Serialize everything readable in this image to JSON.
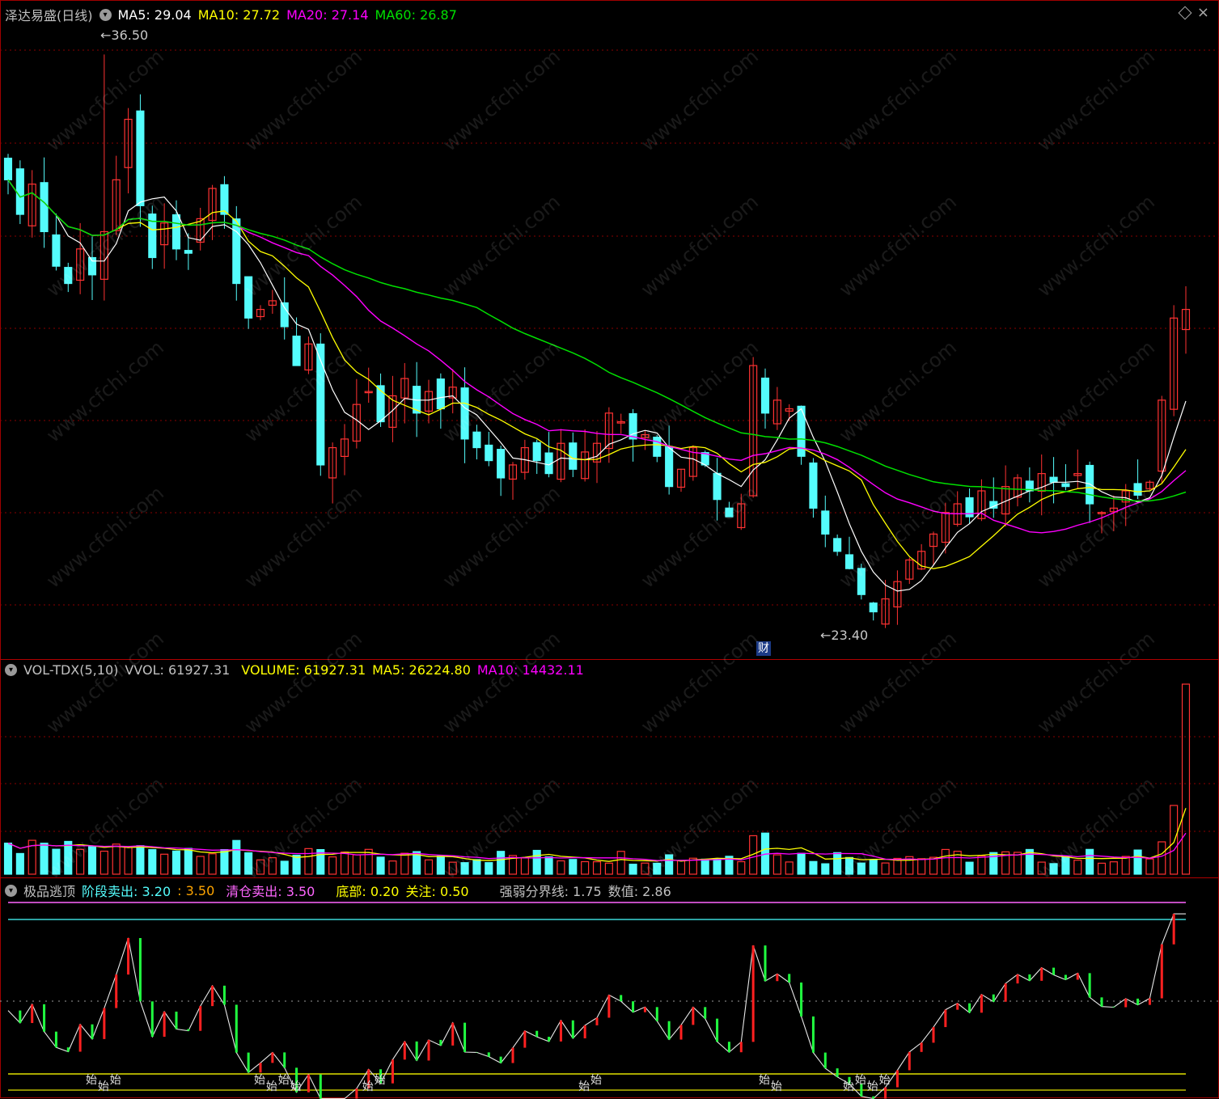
{
  "main_legend": {
    "title": "泽达易盛(日线)",
    "ma5": "MA5: 29.04",
    "ma10": "MA10: 27.72",
    "ma20": "MA20: 27.14",
    "ma60": "MA60: 26.87"
  },
  "annotations": {
    "high": "36.50",
    "low": "23.40",
    "finance_badge": "财"
  },
  "vol_legend": {
    "name": "VOL-TDX(5,10)",
    "vvol": "VVOL: 61927.31",
    "volume": "VOLUME: 61927.31",
    "ma5": "MA5: 26224.80",
    "ma10": "MA10: 14432.11"
  },
  "ind_legend": {
    "name": "极品逃顶",
    "stage_sell_label": "阶段卖出:",
    "stage_sell_val1": "3.20",
    "stage_sell_val2": ": 3.50",
    "clear_sell": "清仓卖出: 3.50",
    "bottom": "底部: 0.20",
    "attention": "关注: 0.50",
    "divider": "强弱分界线: 1.75",
    "value": "数值: 2.86"
  },
  "signal_text": "始",
  "watermark": "www.cfchi.com",
  "colors": {
    "up": "#ff3232",
    "down": "#54fcfc",
    "ma5": "#ffffff",
    "ma10": "#ffff00",
    "ma20": "#ff00ff",
    "ma60": "#00e000",
    "grid": "#8a0000"
  },
  "chart_data": {
    "type": "candlestick",
    "price_range": [
      23.4,
      36.5
    ],
    "closes": [
      33.6,
      32.8,
      33.5,
      32.4,
      31.6,
      31.2,
      32.0,
      31.4,
      32.4,
      33.6,
      35.0,
      33.0,
      31.8,
      32.6,
      32.0,
      31.9,
      32.7,
      33.4,
      32.8,
      31.2,
      30.4,
      30.6,
      30.8,
      30.2,
      29.3,
      29.8,
      27.0,
      27.4,
      27.6,
      28.4,
      28.7,
      28.0,
      28.6,
      29.0,
      28.2,
      28.7,
      28.3,
      28.8,
      27.6,
      27.4,
      27.1,
      26.7,
      27.0,
      27.4,
      27.1,
      26.8,
      27.5,
      26.9,
      27.3,
      27.5,
      28.2,
      28.0,
      27.6,
      27.7,
      27.2,
      26.5,
      26.9,
      27.4,
      27.0,
      26.2,
      25.8,
      26.1,
      29.3,
      28.2,
      28.5,
      28.3,
      27.2,
      26.0,
      25.4,
      25.0,
      24.6,
      24.0,
      23.6,
      23.9,
      24.3,
      24.8,
      25.0,
      25.4,
      25.9,
      26.1,
      25.8,
      26.4,
      26.0,
      26.5,
      26.7,
      26.4,
      26.8,
      26.6,
      26.5,
      26.8,
      26.1,
      25.9,
      26.0,
      26.4,
      26.3,
      26.6,
      28.5,
      30.4,
      30.6
    ],
    "volume_ma5": 26224.8,
    "volume_ma10": 14432.11,
    "volume_last": 61927.31,
    "indicator_levels": {
      "stage_sell": [
        3.2,
        3.5
      ],
      "clear_sell": 3.5,
      "bottom": 0.2,
      "attention": 0.5,
      "divider": 1.75,
      "value": 2.86
    }
  }
}
